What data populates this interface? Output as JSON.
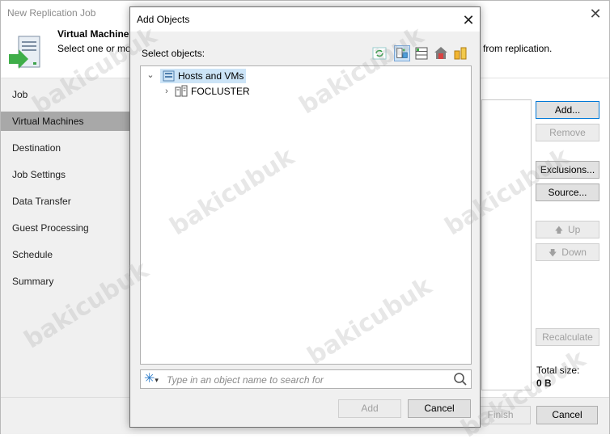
{
  "wizard": {
    "title": "New Replication Job",
    "header_title": "Virtual Machines",
    "header_desc": "Select one or mo",
    "header_desc_tail": "from replication.",
    "steps": [
      "Job",
      "Virtual Machines",
      "Destination",
      "Job Settings",
      "Data Transfer",
      "Guest Processing",
      "Schedule",
      "Summary"
    ],
    "active_step": "Virtual Machines",
    "buttons": {
      "add": "Add...",
      "remove": "Remove",
      "exclusions": "Exclusions...",
      "source": "Source...",
      "up": "Up",
      "down": "Down",
      "recalculate": "Recalculate",
      "finish": "Finish",
      "cancel": "Cancel"
    },
    "total_size_label": "Total size:",
    "total_size_value": "0 B"
  },
  "dialog": {
    "title": "Add Objects",
    "select_label": "Select objects:",
    "toolbar_icons": [
      "refresh-icon",
      "hosts-and-clusters-view-icon",
      "vms-and-templates-view-icon",
      "datastores-view-icon",
      "tags-view-icon"
    ],
    "selected_view": "hosts-and-clusters-view-icon",
    "tree": {
      "root": "Hosts and VMs",
      "children": [
        "FOCLUSTER"
      ]
    },
    "search": {
      "placeholder": "Type in an object name to search for",
      "value": ""
    },
    "buttons": {
      "add": "Add",
      "cancel": "Cancel"
    }
  },
  "watermark_text": "bakicubuk",
  "colors": {
    "active_step_bg": "#a8a8a8",
    "selection_bg": "#cce4f7",
    "primary_button_border": "#0078d7",
    "sidebar_bg": "#f0f0f0"
  }
}
